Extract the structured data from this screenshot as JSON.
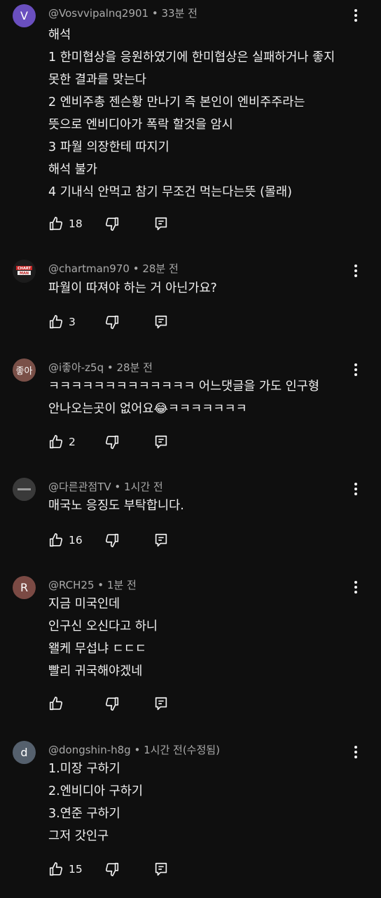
{
  "colors": {
    "background": "#0f0f0f",
    "text": "#f1f1f1",
    "meta": "#aaaaaa"
  },
  "comments": [
    {
      "avatar_letter": "V",
      "avatar_color": "#6a4fbf",
      "author": "@Vosvvipalnq2901",
      "time": "33분 전",
      "lines": [
        "해석",
        "1 한미협상을 응원하였기에 한미협상은 실패하거나 좋지",
        "못한 결과를 맞는다",
        "2 엔비주총 젠슨황 만나기 즉 본인이 엔비주주라는",
        "뜻으로 엔비디아가 폭락 할것을 암시",
        "3 파월 의장한테 따지기",
        "해석 불가",
        "4 기내식 안먹고 참기 무조건 먹는다는뜻 (몰래)"
      ],
      "likes": "18"
    },
    {
      "avatar_letter": "",
      "avatar_color": "#1c1c1c",
      "avatar_kind": "chartman",
      "author": "@chartman970",
      "time": "28분 전",
      "lines": [
        "파월이 따져야 하는 거 아닌가요?"
      ],
      "likes": "3"
    },
    {
      "avatar_letter": "좋아",
      "avatar_color": "#7a5048",
      "author": "@i좋아-z5q",
      "time": "28분 전",
      "lines": [
        "ㅋㅋㅋㅋㅋㅋㅋㅋㅋㅋㅋㅋㅋ 어느댓글을 가도 인구형",
        "안나오는곳이 없어요😂ㅋㅋㅋㅋㅋㅋㅋ"
      ],
      "likes": "2"
    },
    {
      "avatar_letter": "",
      "avatar_color": "#3a3a3a",
      "author": "@다른관점TV",
      "time": "1시간 전",
      "lines": [
        "매국노 응징도 부탁합니다."
      ],
      "likes": "16"
    },
    {
      "avatar_letter": "R",
      "avatar_color": "#7b4a44",
      "author": "@RCH25",
      "time": "1분 전",
      "lines": [
        "지금 미국인데",
        "인구신 오신다고 하니",
        "왤케 무섭냐 ㄷㄷㄷ",
        "빨리 귀국해야겠네"
      ],
      "likes": ""
    },
    {
      "avatar_letter": "d",
      "avatar_color": "#55606d",
      "author": "@dongshin-h8g",
      "time": "1시간 전(수정됨)",
      "lines": [
        "1.미장 구하기",
        "2.엔비디아 구하기",
        "3.연준 구하기",
        "그저 갓인구"
      ],
      "likes": "15"
    }
  ],
  "icons": {
    "like": "thumbs-up-icon",
    "dislike": "thumbs-down-icon",
    "reply": "reply-icon",
    "menu": "more-vert-icon"
  }
}
